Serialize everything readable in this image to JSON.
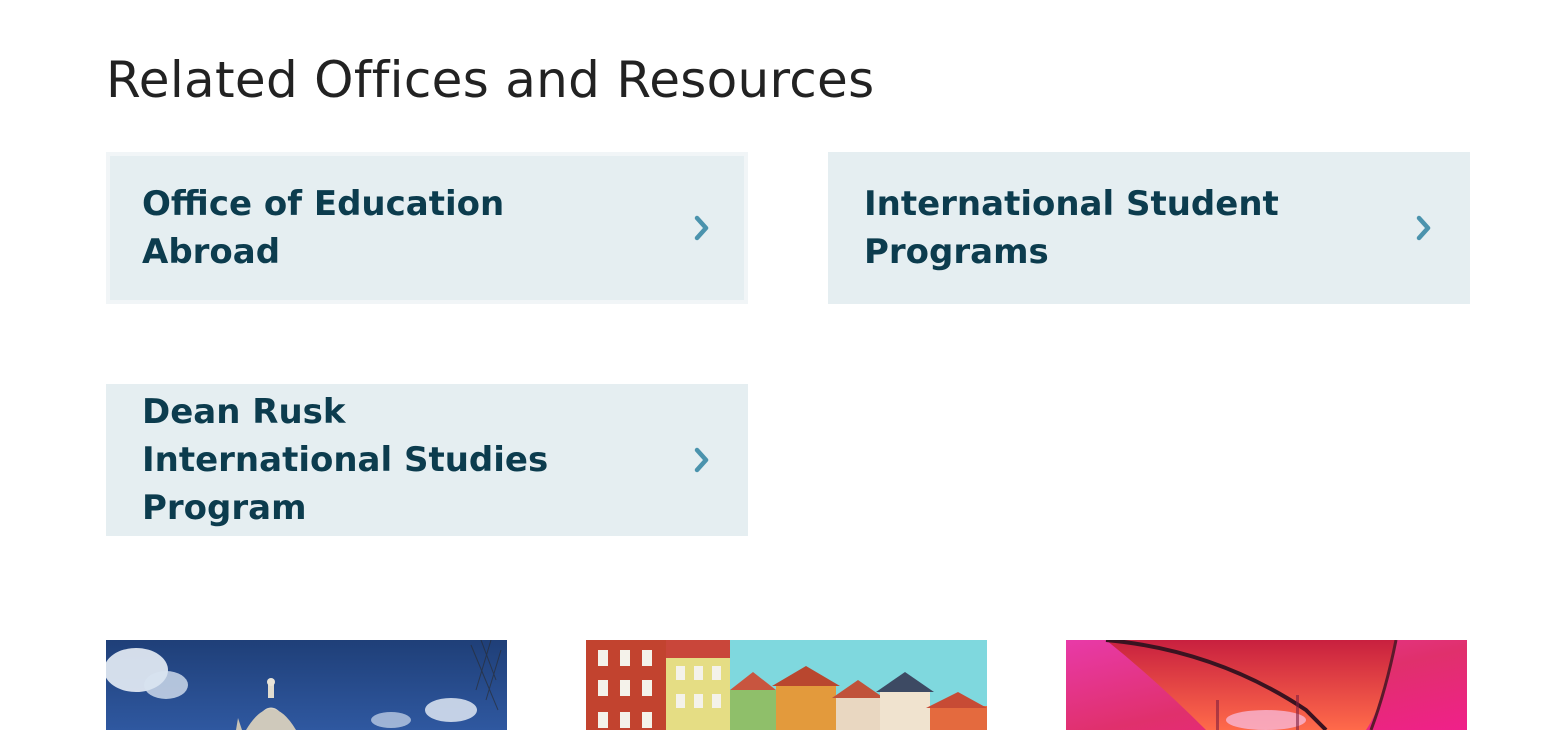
{
  "section": {
    "title": "Related Offices and Resources"
  },
  "resources": [
    {
      "label": "Office of Education Abroad",
      "icon": "chevron-right-icon"
    },
    {
      "label": "International Student Programs",
      "icon": "chevron-right-icon"
    },
    {
      "label": "Dean Rusk International Studies Program",
      "icon": "chevron-right-icon"
    }
  ],
  "colors": {
    "card_background": "#e5eef1",
    "card_text": "#0c3c4e",
    "chevron": "#4b93ad",
    "heading": "#222222"
  },
  "gallery": [
    {
      "image": "domed-cathedral-blue-sky-photo"
    },
    {
      "image": "colorful-harbor-townhouses-photo"
    },
    {
      "image": "pink-glass-panorama-photo"
    }
  ]
}
